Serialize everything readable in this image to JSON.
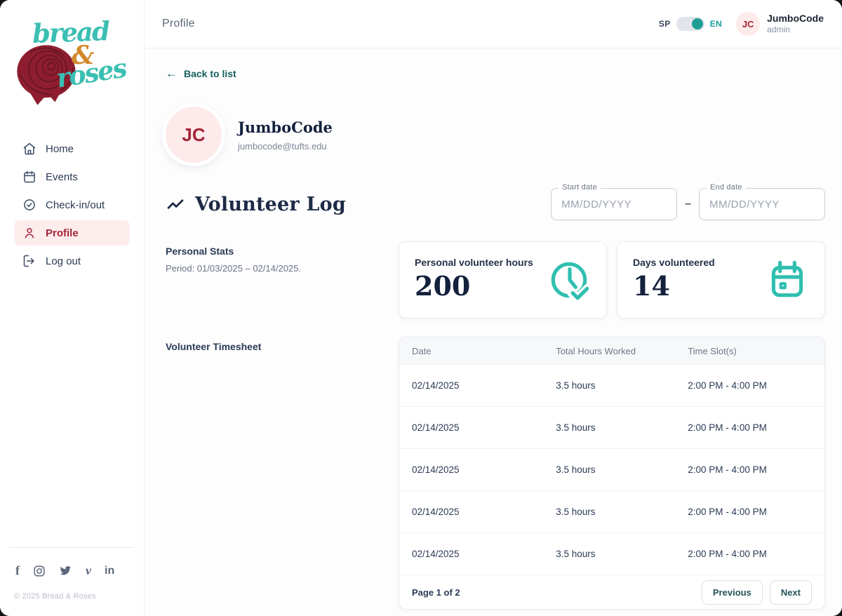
{
  "logo": {
    "word1": "bread",
    "amp": "&",
    "word2": "roses"
  },
  "sidebar": {
    "items": [
      {
        "label": "Home",
        "icon": "home-icon",
        "active": false
      },
      {
        "label": "Events",
        "icon": "calendar-icon",
        "active": false
      },
      {
        "label": "Check-in/out",
        "icon": "check-circle-icon",
        "active": false
      },
      {
        "label": "Profile",
        "icon": "person-icon",
        "active": true
      },
      {
        "label": "Log out",
        "icon": "logout-icon",
        "active": false
      }
    ],
    "social": [
      "facebook",
      "instagram",
      "twitter",
      "vimeo",
      "linkedin"
    ],
    "copyright": "© 2025 Bread & Roses"
  },
  "header": {
    "title": "Profile",
    "lang_left": "SP",
    "lang_right": "EN",
    "user": {
      "initials": "JC",
      "name": "JumboCode",
      "role": "admin"
    }
  },
  "profile": {
    "back_label": "Back to list",
    "back_arrow": "←",
    "initials": "JC",
    "name": "JumboCode",
    "email": "jumbocode@tufts.edu"
  },
  "volunteer_log": {
    "title": "Volunteer Log",
    "start_label": "Start date",
    "end_label": "End date",
    "date_placeholder": "MM/DD/YYYY",
    "range_separator": "–"
  },
  "personal_stats": {
    "heading": "Personal Stats",
    "period": "Period: 01/03/2025 – 02/14/2025.",
    "cards": [
      {
        "label": "Personal volunteer hours",
        "value": "200",
        "icon": "clock-check-icon"
      },
      {
        "label": "Days volunteered",
        "value": "14",
        "icon": "calendar-check-icon"
      }
    ]
  },
  "timesheet": {
    "heading": "Volunteer Timesheet",
    "columns": [
      "Date",
      "Total Hours Worked",
      "Time Slot(s)"
    ],
    "rows": [
      {
        "date": "02/14/2025",
        "hours": "3.5 hours",
        "slot": "2:00 PM - 4:00 PM"
      },
      {
        "date": "02/14/2025",
        "hours": "3.5 hours",
        "slot": "2:00 PM - 4:00 PM"
      },
      {
        "date": "02/14/2025",
        "hours": "3.5 hours",
        "slot": "2:00 PM - 4:00 PM"
      },
      {
        "date": "02/14/2025",
        "hours": "3.5 hours",
        "slot": "2:00 PM - 4:00 PM"
      },
      {
        "date": "02/14/2025",
        "hours": "3.5 hours",
        "slot": "2:00 PM - 4:00 PM"
      }
    ],
    "pagination": {
      "status": "Page 1 of 2",
      "previous": "Previous",
      "next": "Next"
    }
  },
  "colors": {
    "accent_teal": "#2fbfb0",
    "link_teal_dark": "#155f5c",
    "crimson": "#a32638",
    "pink_bg": "#fdeaea",
    "navy_text": "#1d2b45",
    "gray_text": "#6e7787",
    "border": "#e9ebf0",
    "logo_teal": "#3bbfb3",
    "logo_orange": "#d2882b",
    "logo_rose_red": "#8e1e2f"
  }
}
